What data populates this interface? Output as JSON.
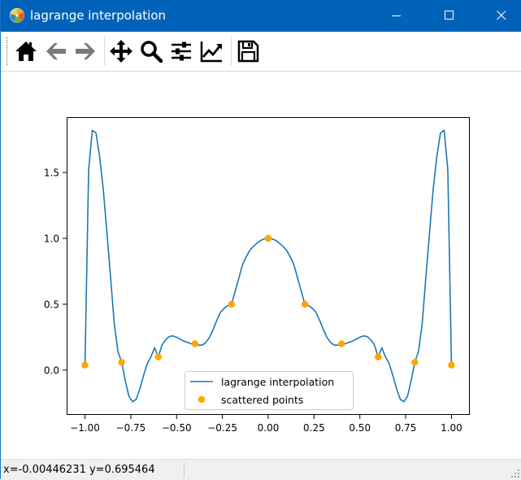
{
  "window": {
    "title": "lagrange interpolation",
    "controls": [
      "minimize",
      "maximize",
      "close"
    ]
  },
  "toolbar": {
    "buttons": [
      {
        "name": "home",
        "icon": "home-icon",
        "tooltip": "Reset original view"
      },
      {
        "name": "back",
        "icon": "arrow-left-icon",
        "tooltip": "Back to previous view"
      },
      {
        "name": "forward",
        "icon": "arrow-right-icon",
        "tooltip": "Forward to next view"
      },
      {
        "name": "pan",
        "icon": "move-icon",
        "tooltip": "Pan axes"
      },
      {
        "name": "zoom",
        "icon": "magnifier-icon",
        "tooltip": "Zoom to rectangle"
      },
      {
        "name": "subplots",
        "icon": "sliders-icon",
        "tooltip": "Configure subplots"
      },
      {
        "name": "customize",
        "icon": "line-chart-icon",
        "tooltip": "Edit axis"
      },
      {
        "name": "save",
        "icon": "floppy-disk-icon",
        "tooltip": "Save the figure"
      }
    ]
  },
  "status": {
    "coords": "x=-0.00446231  y=0.695464"
  },
  "colors": {
    "titlebar": "#0062b8",
    "line": "#1f77b4",
    "points": "#ffa500"
  },
  "chart_data": {
    "type": "line",
    "title": "",
    "xlabel": "",
    "ylabel": "",
    "xlim": [
      -1.1,
      1.1
    ],
    "ylim": [
      -0.34,
      1.92
    ],
    "xticks": [
      -1.0,
      -0.75,
      -0.5,
      -0.25,
      0.0,
      0.25,
      0.5,
      0.75,
      1.0
    ],
    "xtick_labels": [
      "−1.00",
      "−0.75",
      "−0.50",
      "−0.25",
      "0.00",
      "0.25",
      "0.50",
      "0.75",
      "1.00"
    ],
    "yticks": [
      0.0,
      0.5,
      1.0,
      1.5
    ],
    "ytick_labels": [
      "0.0",
      "0.5",
      "1.0",
      "1.5"
    ],
    "grid": false,
    "legend_position": "lower center",
    "series": [
      {
        "name": "lagrange interpolation",
        "kind": "line",
        "color": "#1f77b4",
        "x": [
          -1.0,
          -0.98,
          -0.96,
          -0.94,
          -0.92,
          -0.9,
          -0.88,
          -0.86,
          -0.84,
          -0.82,
          -0.8,
          -0.78,
          -0.76,
          -0.74,
          -0.72,
          -0.7,
          -0.68,
          -0.66,
          -0.64,
          -0.62,
          -0.6,
          -0.58,
          -0.56,
          -0.54,
          -0.52,
          -0.5,
          -0.48,
          -0.46,
          -0.44,
          -0.42,
          -0.4,
          -0.38,
          -0.36,
          -0.34,
          -0.32,
          -0.3,
          -0.28,
          -0.26,
          -0.24,
          -0.22,
          -0.2,
          -0.18,
          -0.16,
          -0.14,
          -0.12,
          -0.1,
          -0.08,
          -0.06,
          -0.04,
          -0.02,
          0.0,
          0.02,
          0.04,
          0.06,
          0.08,
          0.1,
          0.12,
          0.14,
          0.16,
          0.18,
          0.2,
          0.22,
          0.24,
          0.26,
          0.28,
          0.3,
          0.32,
          0.34,
          0.36,
          0.38,
          0.4,
          0.42,
          0.44,
          0.46,
          0.48,
          0.5,
          0.52,
          0.54,
          0.56,
          0.58,
          0.6,
          0.62,
          0.64,
          0.66,
          0.68,
          0.7,
          0.72,
          0.74,
          0.76,
          0.78,
          0.8,
          0.82,
          0.84,
          0.86,
          0.88,
          0.9,
          0.92,
          0.94,
          0.96,
          0.98,
          1.0
        ],
        "y": [
          0.038,
          1.52,
          1.82,
          1.8,
          1.62,
          1.37,
          1.04,
          0.7,
          0.35,
          0.14,
          0.062,
          -0.08,
          -0.2,
          -0.24,
          -0.22,
          -0.14,
          -0.04,
          0.05,
          0.1,
          0.17,
          0.1,
          0.19,
          0.23,
          0.255,
          0.26,
          0.25,
          0.235,
          0.22,
          0.21,
          0.2,
          0.196,
          0.19,
          0.19,
          0.21,
          0.25,
          0.31,
          0.38,
          0.44,
          0.47,
          0.49,
          0.5,
          0.6,
          0.7,
          0.8,
          0.86,
          0.91,
          0.94,
          0.965,
          0.985,
          0.997,
          1.0,
          0.997,
          0.985,
          0.965,
          0.94,
          0.91,
          0.86,
          0.8,
          0.7,
          0.6,
          0.5,
          0.49,
          0.47,
          0.44,
          0.38,
          0.31,
          0.25,
          0.21,
          0.19,
          0.19,
          0.196,
          0.2,
          0.21,
          0.22,
          0.235,
          0.25,
          0.26,
          0.255,
          0.23,
          0.19,
          0.1,
          0.17,
          0.1,
          0.05,
          -0.04,
          -0.14,
          -0.22,
          -0.24,
          -0.2,
          -0.08,
          0.062,
          0.14,
          0.35,
          0.7,
          1.04,
          1.37,
          1.62,
          1.8,
          1.82,
          1.52,
          0.038
        ]
      },
      {
        "name": "scattered points",
        "kind": "scatter",
        "color": "#ffa500",
        "x": [
          -1.0,
          -0.8,
          -0.6,
          -0.4,
          -0.2,
          0.0,
          0.2,
          0.4,
          0.6,
          0.8,
          1.0
        ],
        "y": [
          0.038,
          0.059,
          0.1,
          0.2,
          0.5,
          1.0,
          0.5,
          0.2,
          0.1,
          0.059,
          0.038
        ]
      }
    ]
  }
}
